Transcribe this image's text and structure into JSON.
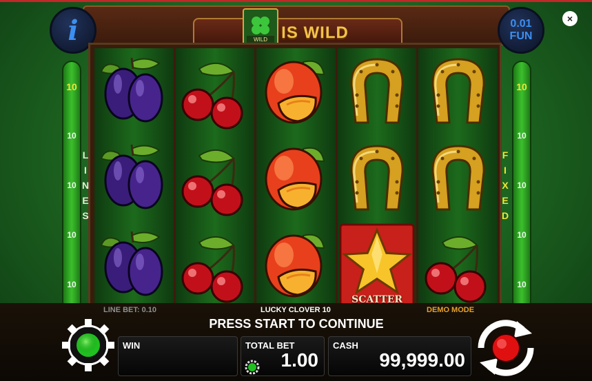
{
  "header": {
    "wild_text": "IS WILD",
    "clover_label": "WILD",
    "info_symbol": "i",
    "denomination_value": "0.01",
    "denomination_currency": "FUN",
    "close_symbol": "×"
  },
  "side": {
    "left_label": [
      "L",
      "I",
      "N",
      "E",
      "S"
    ],
    "right_label": [
      "F",
      "I",
      "X",
      "E",
      "D"
    ],
    "line_numbers": [
      "10",
      "10",
      "10",
      "10",
      "10"
    ]
  },
  "reels": [
    [
      "plum",
      "plum",
      "plum"
    ],
    [
      "cherry",
      "cherry",
      "cherry"
    ],
    [
      "peach",
      "peach",
      "peach"
    ],
    [
      "horseshoe",
      "horseshoe",
      "scatter"
    ],
    [
      "horseshoe",
      "horseshoe",
      "cherry"
    ]
  ],
  "scatter_label": "SCATTER",
  "status": {
    "line_bet": "LINE BET: 0.10",
    "game_name": "LUCKY CLOVER 10",
    "mode": "DEMO MODE",
    "message": "PRESS START TO CONTINUE"
  },
  "panels": {
    "win_label": "WIN",
    "win_value": "",
    "total_bet_label": "TOTAL BET",
    "total_bet_value": "1.00",
    "cash_label": "CASH",
    "cash_value": "99,999.00"
  },
  "colors": {
    "accent_gold": "#f3c24a",
    "line_number_top": "#f2e534",
    "mode_text": "#e8a12a",
    "gear_green": "#20c020",
    "spin_red": "#e01010"
  }
}
